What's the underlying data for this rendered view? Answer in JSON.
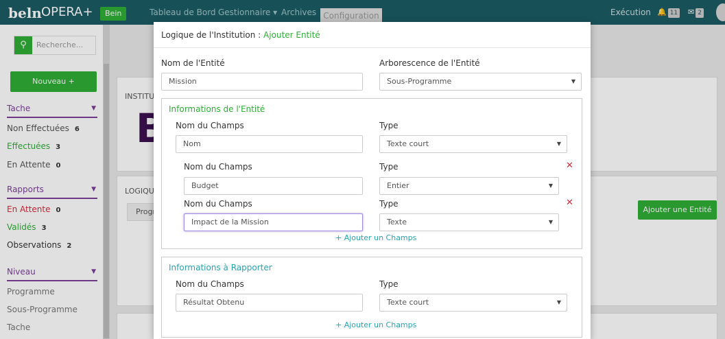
{
  "topbar": {
    "logo": "beln",
    "brand": "OPERA+",
    "bein_label": "Bein",
    "nav": [
      "Tableau de Bord",
      "Gestionnaire ▾",
      "Archives"
    ],
    "active_nav": "Configuration",
    "execution": "Exécution",
    "bell_count": "11",
    "mail_count": "2"
  },
  "sidebar": {
    "search_placeholder": "Recherche...",
    "new_button": "Nouveau +",
    "tache": {
      "title": "Tache",
      "items": [
        {
          "label": "Non Effectuées",
          "count": "6"
        },
        {
          "label": "Effectuées",
          "count": "3"
        },
        {
          "label": "En Attente",
          "count": "0"
        }
      ]
    },
    "rapports": {
      "title": "Rapports",
      "items": [
        {
          "label": "En Attente",
          "count": "0"
        },
        {
          "label": "Validés",
          "count": "3"
        },
        {
          "label": "Observations",
          "count": "2"
        }
      ]
    },
    "niveau": {
      "title": "Niveau",
      "items": [
        "Programme",
        "Sous-Programme",
        "Tache"
      ]
    }
  },
  "background": {
    "institution_title": "INSTITUT",
    "logique_title": "LOGIQU",
    "prog_tab": "Progr",
    "add_entity_button": "Ajouter une Entité",
    "big_letter": "B"
  },
  "modal": {
    "title_prefix": "Logique de l'Institution : ",
    "title_action": "Ajouter Entité",
    "entity_name_label": "Nom de l'Entité",
    "entity_name_value": "Mission",
    "tree_label": "Arborescence de l'Entité",
    "tree_value": "Sous-Programme",
    "info_entity": {
      "title": "Informations de l'Entité",
      "fields": [
        {
          "name_label": "Nom du Champs",
          "name_value": "Nom",
          "type_label": "Type",
          "type_value": "Texte court"
        },
        {
          "name_label": "Nom du Champs",
          "name_value": "Budget",
          "type_label": "Type",
          "type_value": "Entier"
        },
        {
          "name_label": "Nom du Champs",
          "name_value": "Impact de la Mission",
          "type_label": "Type",
          "type_value": "Texte"
        }
      ],
      "add_field": "+ Ajouter un Champs"
    },
    "info_report": {
      "title": "Informations à Rapporter",
      "fields": [
        {
          "name_label": "Nom du Champs",
          "name_value": "Résultat Obtenu",
          "type_label": "Type",
          "type_value": "Texte court"
        }
      ],
      "add_field": "+ Ajouter un Champs"
    }
  },
  "colors": {
    "topbar": "#1c5c64",
    "accent_green": "#2eae36",
    "purple": "#7b3f98",
    "remove_red": "#e0283b",
    "link_teal": "#29a3b3"
  }
}
